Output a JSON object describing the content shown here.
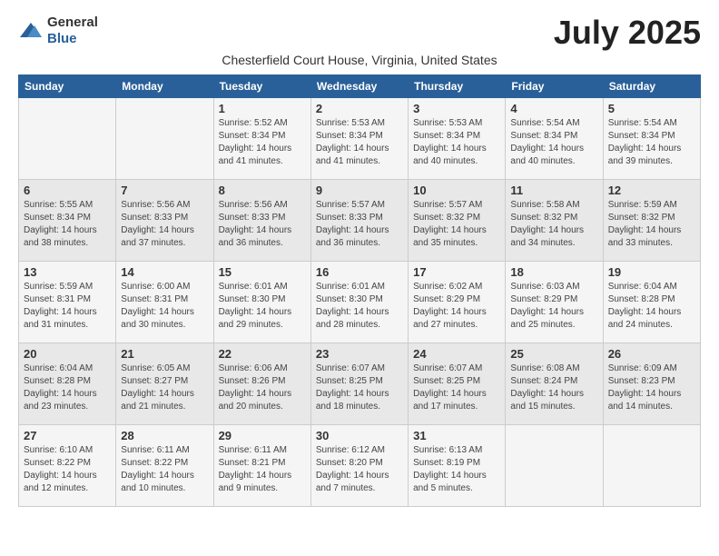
{
  "logo": {
    "general": "General",
    "blue": "Blue"
  },
  "title": "July 2025",
  "subtitle": "Chesterfield Court House, Virginia, United States",
  "weekdays": [
    "Sunday",
    "Monday",
    "Tuesday",
    "Wednesday",
    "Thursday",
    "Friday",
    "Saturday"
  ],
  "weeks": [
    [
      {
        "day": "",
        "sunrise": "",
        "sunset": "",
        "daylight": ""
      },
      {
        "day": "",
        "sunrise": "",
        "sunset": "",
        "daylight": ""
      },
      {
        "day": "1",
        "sunrise": "Sunrise: 5:52 AM",
        "sunset": "Sunset: 8:34 PM",
        "daylight": "Daylight: 14 hours and 41 minutes."
      },
      {
        "day": "2",
        "sunrise": "Sunrise: 5:53 AM",
        "sunset": "Sunset: 8:34 PM",
        "daylight": "Daylight: 14 hours and 41 minutes."
      },
      {
        "day": "3",
        "sunrise": "Sunrise: 5:53 AM",
        "sunset": "Sunset: 8:34 PM",
        "daylight": "Daylight: 14 hours and 40 minutes."
      },
      {
        "day": "4",
        "sunrise": "Sunrise: 5:54 AM",
        "sunset": "Sunset: 8:34 PM",
        "daylight": "Daylight: 14 hours and 40 minutes."
      },
      {
        "day": "5",
        "sunrise": "Sunrise: 5:54 AM",
        "sunset": "Sunset: 8:34 PM",
        "daylight": "Daylight: 14 hours and 39 minutes."
      }
    ],
    [
      {
        "day": "6",
        "sunrise": "Sunrise: 5:55 AM",
        "sunset": "Sunset: 8:34 PM",
        "daylight": "Daylight: 14 hours and 38 minutes."
      },
      {
        "day": "7",
        "sunrise": "Sunrise: 5:56 AM",
        "sunset": "Sunset: 8:33 PM",
        "daylight": "Daylight: 14 hours and 37 minutes."
      },
      {
        "day": "8",
        "sunrise": "Sunrise: 5:56 AM",
        "sunset": "Sunset: 8:33 PM",
        "daylight": "Daylight: 14 hours and 36 minutes."
      },
      {
        "day": "9",
        "sunrise": "Sunrise: 5:57 AM",
        "sunset": "Sunset: 8:33 PM",
        "daylight": "Daylight: 14 hours and 36 minutes."
      },
      {
        "day": "10",
        "sunrise": "Sunrise: 5:57 AM",
        "sunset": "Sunset: 8:32 PM",
        "daylight": "Daylight: 14 hours and 35 minutes."
      },
      {
        "day": "11",
        "sunrise": "Sunrise: 5:58 AM",
        "sunset": "Sunset: 8:32 PM",
        "daylight": "Daylight: 14 hours and 34 minutes."
      },
      {
        "day": "12",
        "sunrise": "Sunrise: 5:59 AM",
        "sunset": "Sunset: 8:32 PM",
        "daylight": "Daylight: 14 hours and 33 minutes."
      }
    ],
    [
      {
        "day": "13",
        "sunrise": "Sunrise: 5:59 AM",
        "sunset": "Sunset: 8:31 PM",
        "daylight": "Daylight: 14 hours and 31 minutes."
      },
      {
        "day": "14",
        "sunrise": "Sunrise: 6:00 AM",
        "sunset": "Sunset: 8:31 PM",
        "daylight": "Daylight: 14 hours and 30 minutes."
      },
      {
        "day": "15",
        "sunrise": "Sunrise: 6:01 AM",
        "sunset": "Sunset: 8:30 PM",
        "daylight": "Daylight: 14 hours and 29 minutes."
      },
      {
        "day": "16",
        "sunrise": "Sunrise: 6:01 AM",
        "sunset": "Sunset: 8:30 PM",
        "daylight": "Daylight: 14 hours and 28 minutes."
      },
      {
        "day": "17",
        "sunrise": "Sunrise: 6:02 AM",
        "sunset": "Sunset: 8:29 PM",
        "daylight": "Daylight: 14 hours and 27 minutes."
      },
      {
        "day": "18",
        "sunrise": "Sunrise: 6:03 AM",
        "sunset": "Sunset: 8:29 PM",
        "daylight": "Daylight: 14 hours and 25 minutes."
      },
      {
        "day": "19",
        "sunrise": "Sunrise: 6:04 AM",
        "sunset": "Sunset: 8:28 PM",
        "daylight": "Daylight: 14 hours and 24 minutes."
      }
    ],
    [
      {
        "day": "20",
        "sunrise": "Sunrise: 6:04 AM",
        "sunset": "Sunset: 8:28 PM",
        "daylight": "Daylight: 14 hours and 23 minutes."
      },
      {
        "day": "21",
        "sunrise": "Sunrise: 6:05 AM",
        "sunset": "Sunset: 8:27 PM",
        "daylight": "Daylight: 14 hours and 21 minutes."
      },
      {
        "day": "22",
        "sunrise": "Sunrise: 6:06 AM",
        "sunset": "Sunset: 8:26 PM",
        "daylight": "Daylight: 14 hours and 20 minutes."
      },
      {
        "day": "23",
        "sunrise": "Sunrise: 6:07 AM",
        "sunset": "Sunset: 8:25 PM",
        "daylight": "Daylight: 14 hours and 18 minutes."
      },
      {
        "day": "24",
        "sunrise": "Sunrise: 6:07 AM",
        "sunset": "Sunset: 8:25 PM",
        "daylight": "Daylight: 14 hours and 17 minutes."
      },
      {
        "day": "25",
        "sunrise": "Sunrise: 6:08 AM",
        "sunset": "Sunset: 8:24 PM",
        "daylight": "Daylight: 14 hours and 15 minutes."
      },
      {
        "day": "26",
        "sunrise": "Sunrise: 6:09 AM",
        "sunset": "Sunset: 8:23 PM",
        "daylight": "Daylight: 14 hours and 14 minutes."
      }
    ],
    [
      {
        "day": "27",
        "sunrise": "Sunrise: 6:10 AM",
        "sunset": "Sunset: 8:22 PM",
        "daylight": "Daylight: 14 hours and 12 minutes."
      },
      {
        "day": "28",
        "sunrise": "Sunrise: 6:11 AM",
        "sunset": "Sunset: 8:22 PM",
        "daylight": "Daylight: 14 hours and 10 minutes."
      },
      {
        "day": "29",
        "sunrise": "Sunrise: 6:11 AM",
        "sunset": "Sunset: 8:21 PM",
        "daylight": "Daylight: 14 hours and 9 minutes."
      },
      {
        "day": "30",
        "sunrise": "Sunrise: 6:12 AM",
        "sunset": "Sunset: 8:20 PM",
        "daylight": "Daylight: 14 hours and 7 minutes."
      },
      {
        "day": "31",
        "sunrise": "Sunrise: 6:13 AM",
        "sunset": "Sunset: 8:19 PM",
        "daylight": "Daylight: 14 hours and 5 minutes."
      },
      {
        "day": "",
        "sunrise": "",
        "sunset": "",
        "daylight": ""
      },
      {
        "day": "",
        "sunrise": "",
        "sunset": "",
        "daylight": ""
      }
    ]
  ]
}
